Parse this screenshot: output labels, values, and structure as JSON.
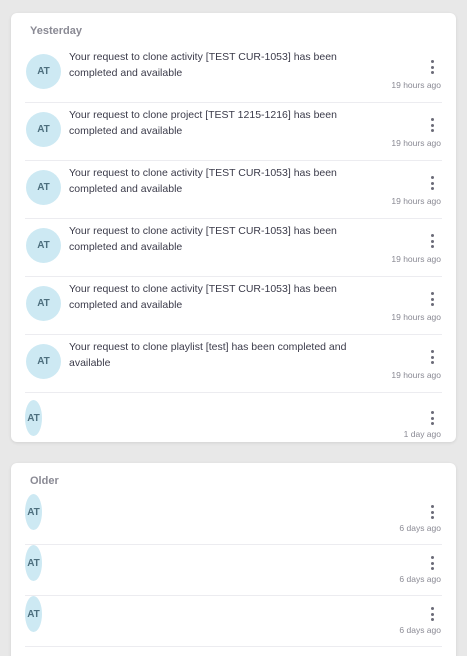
{
  "colors": {
    "background": "#e8e8e8",
    "card": "#ffffff",
    "avatar_bg": "#cde9f3",
    "avatar_text": "#4d6f7e",
    "section_title": "#8a8a94",
    "time_text": "#8a8a94"
  },
  "sections": {
    "yesterday": {
      "title": "Yesterday",
      "items": [
        {
          "avatar": "AT",
          "message": "Your request to clone activity [TEST CUR-1053] has been completed and available",
          "time": "19 hours ago",
          "menu_icon": "more-vertical-icon"
        },
        {
          "avatar": "AT",
          "message": "Your request to clone project [TEST 1215-1216] has been completed and available",
          "time": "19 hours ago",
          "menu_icon": "more-vertical-icon"
        },
        {
          "avatar": "AT",
          "message": "Your request to clone activity [TEST CUR-1053] has been completed and available",
          "time": "19 hours ago",
          "menu_icon": "more-vertical-icon"
        },
        {
          "avatar": "AT",
          "message": "Your request to clone activity [TEST CUR-1053] has been completed and available",
          "time": "19 hours ago",
          "menu_icon": "more-vertical-icon"
        },
        {
          "avatar": "AT",
          "message": "Your request to clone activity [TEST CUR-1053] has been completed and available",
          "time": "19 hours ago",
          "menu_icon": "more-vertical-icon"
        },
        {
          "avatar": "AT",
          "message": "Your request to clone playlist [test] has been completed and available",
          "time": "19 hours ago",
          "menu_icon": "more-vertical-icon"
        },
        {
          "avatar": "AT",
          "message": "",
          "time": "1 day ago",
          "menu_icon": "more-vertical-icon"
        }
      ]
    },
    "older": {
      "title": "Older",
      "items": [
        {
          "avatar": "AT",
          "message": "",
          "time": "6 days ago",
          "menu_icon": "more-vertical-icon"
        },
        {
          "avatar": "AT",
          "message": "",
          "time": "6 days ago",
          "menu_icon": "more-vertical-icon"
        },
        {
          "avatar": "AT",
          "message": "",
          "time": "6 days ago",
          "menu_icon": "more-vertical-icon"
        }
      ]
    }
  }
}
